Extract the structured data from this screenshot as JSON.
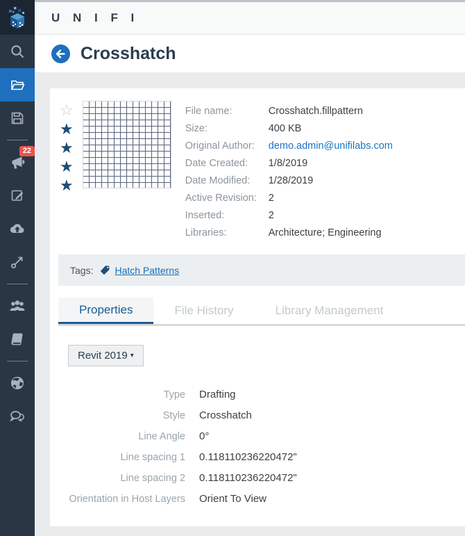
{
  "app": {
    "brand": "U N I F I"
  },
  "sidebar": {
    "badge_count": "22",
    "items": [
      {
        "name": "logo"
      },
      {
        "name": "search"
      },
      {
        "name": "browse",
        "active": true
      },
      {
        "name": "save"
      },
      {
        "name": "announcements",
        "badge": "22"
      },
      {
        "name": "edit"
      },
      {
        "name": "cloud-upload"
      },
      {
        "name": "share"
      },
      {
        "name": "users"
      },
      {
        "name": "library"
      },
      {
        "name": "web"
      },
      {
        "name": "chat"
      }
    ]
  },
  "page": {
    "title": "Crosshatch"
  },
  "rating": {
    "stars": [
      "☆",
      "★",
      "★",
      "★",
      "★"
    ],
    "filled": 4
  },
  "details": [
    {
      "label": "File name:",
      "value": "Crosshatch.fillpattern"
    },
    {
      "label": "Size:",
      "value": "400 KB"
    },
    {
      "label": "Original Author:",
      "value": "demo.admin@unifilabs.com"
    },
    {
      "label": "Date Created:",
      "value": "1/8/2019"
    },
    {
      "label": "Date Modified:",
      "value": "1/28/2019"
    },
    {
      "label": "Active Revision:",
      "value": "2"
    },
    {
      "label": "Inserted:",
      "value": "2"
    },
    {
      "label": "Libraries:",
      "value": "Architecture; Engineering"
    }
  ],
  "tags": {
    "label": "Tags:",
    "items": [
      "Hatch Patterns"
    ]
  },
  "tabs": {
    "active": "Properties",
    "items": [
      {
        "label": "Properties"
      },
      {
        "label": "File History"
      },
      {
        "label": "Library Management"
      }
    ]
  },
  "version_selector": {
    "label": "Revit 2019"
  },
  "properties": [
    {
      "label": "Type",
      "value": "Drafting"
    },
    {
      "label": "Style",
      "value": "Crosshatch"
    },
    {
      "label": "Line Angle",
      "value": "0°"
    },
    {
      "label": "Line spacing 1",
      "value": "0.118110236220472\""
    },
    {
      "label": "Line spacing 2",
      "value": "0.118110236220472\""
    },
    {
      "label": "Orientation in Host Layers",
      "value": "Orient To View"
    }
  ],
  "colors": {
    "sidebar": "#2b3644",
    "accent_blue": "#1e6fbd",
    "star_navy": "#1d4e79",
    "link_blue": "#1a73c8",
    "tab_active_blue": "#1a5c96",
    "badge_red": "#e8544d"
  }
}
